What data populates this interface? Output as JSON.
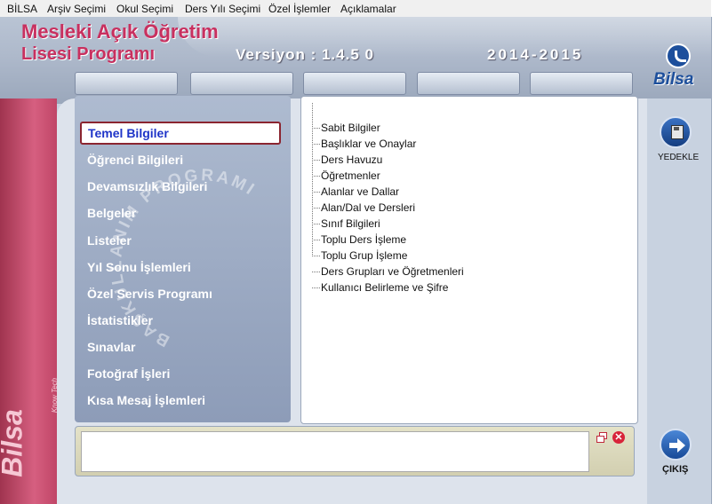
{
  "menu": [
    "BİLSA",
    "Arşiv Seçimi",
    "Okul Seçimi",
    "Ders Yılı Seçimi",
    "Özel İşlemler",
    "Açıklamalar"
  ],
  "header": {
    "title_line1": "Mesleki Açık Öğretim",
    "title_line2": "Lisesi Programı",
    "version": "Versiyon : 1.4.5 0",
    "years": "2014-2015",
    "logo_text": "Bilsa"
  },
  "nav": {
    "watermark": "BAŞKULLANIM PROGRAMI",
    "items": [
      "Temel Bilgiler",
      "Öğrenci Bilgileri",
      "Devamsızlık Bilgileri",
      "Belgeler",
      "Listeler",
      "Yıl Sonu İşlemleri",
      "Özel Servis Programı",
      "İstatistikler",
      "Sınavlar",
      "Fotoğraf İşleri",
      "Kısa Mesaj İşlemleri"
    ],
    "active_index": 0
  },
  "tree": {
    "items": [
      "Sabit Bilgiler",
      "Başlıklar ve Onaylar",
      "Ders Havuzu",
      "Öğretmenler",
      "Alanlar ve Dallar",
      "Alan/Dal ve Dersleri",
      "Sınıf Bilgileri",
      "Toplu Ders İşleme",
      "Toplu Grup İşleme",
      "Ders Grupları ve Öğretmenleri",
      "Kullanıcı Belirleme ve Şifre"
    ]
  },
  "side": {
    "backup_label": "YEDEKLE",
    "exit_label": "ÇIKIŞ",
    "left_logo": "Bilsa",
    "left_logo_small": "Know Tech"
  },
  "colors": {
    "title": "#c8305f",
    "active_text": "#1e34c8",
    "active_border": "#8b2530",
    "accent_blue": "#1d4f9c"
  }
}
